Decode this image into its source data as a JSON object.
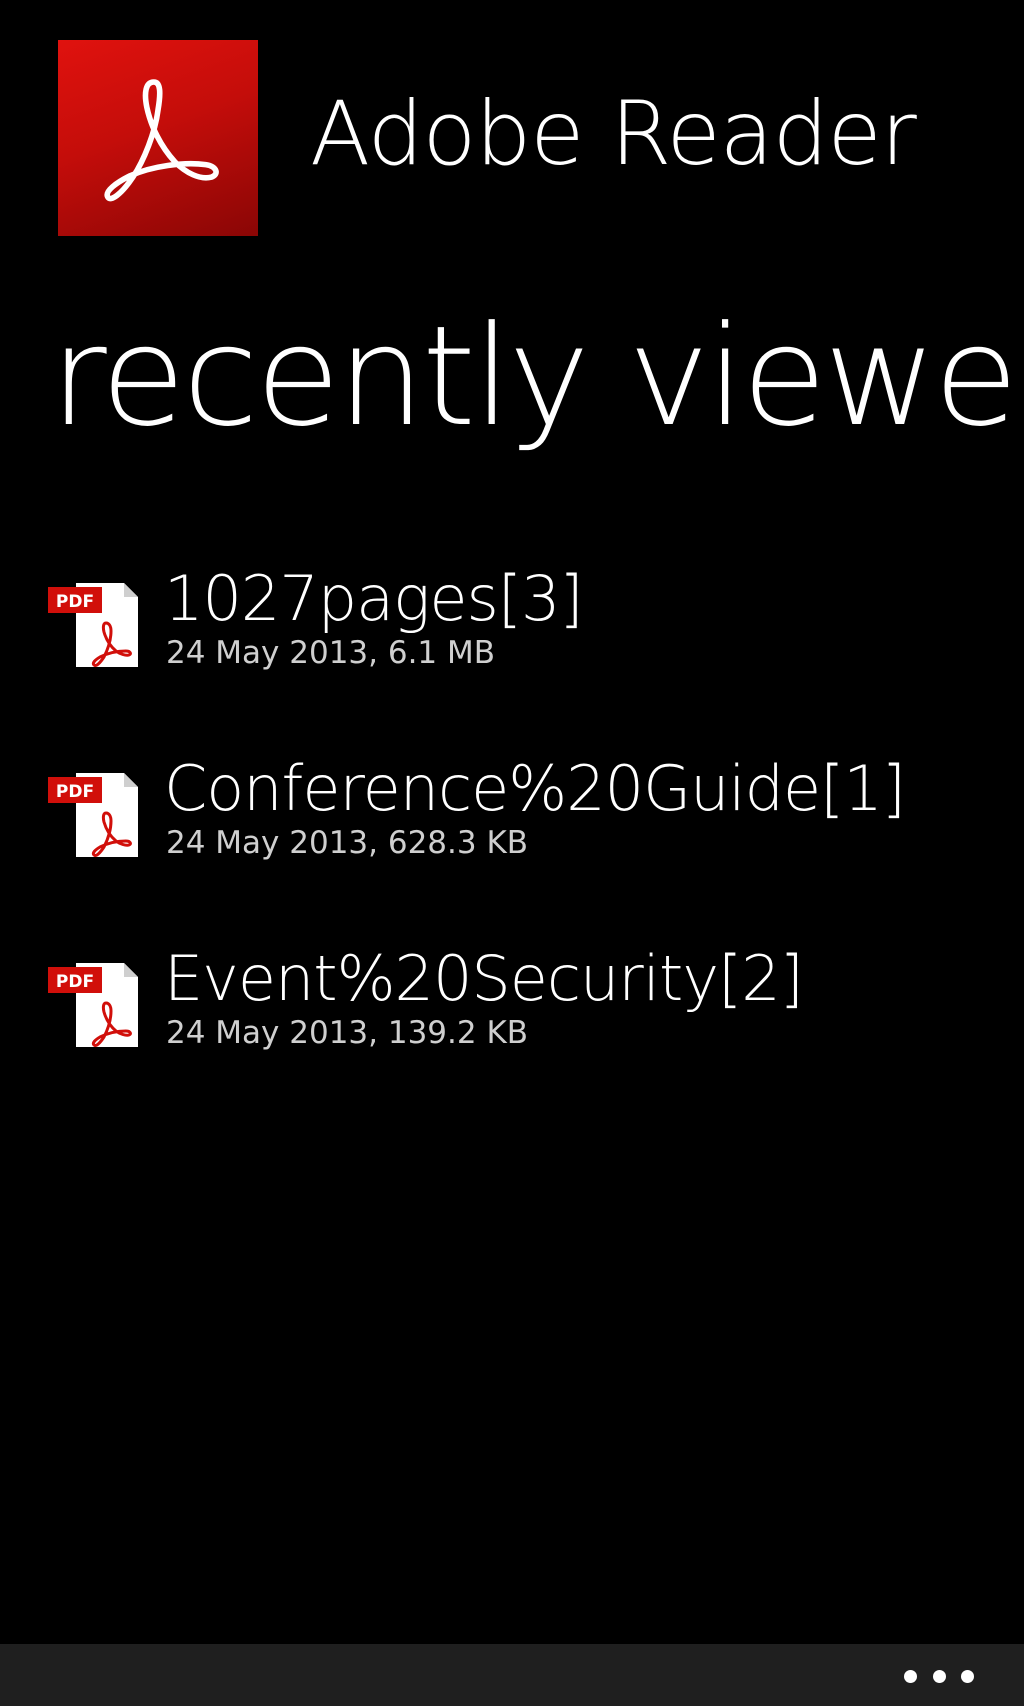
{
  "app": {
    "name": "Adobe Reader",
    "logo_icon": "adobe-reader-logo-icon",
    "brand_color": "#d3100c"
  },
  "page": {
    "title": "recently viewed"
  },
  "recent_documents": [
    {
      "name": "1027pages[3]",
      "meta": "24 May 2013, 6.1 MB",
      "icon": "pdf-file-icon"
    },
    {
      "name": "Conference%20Guide[1]",
      "meta": "24 May 2013, 628.3 KB",
      "icon": "pdf-file-icon"
    },
    {
      "name": "Event%20Security[2]",
      "meta": "24 May 2013, 139.2 KB",
      "icon": "pdf-file-icon"
    }
  ],
  "app_bar": {
    "more_icon": "more-options-icon"
  }
}
